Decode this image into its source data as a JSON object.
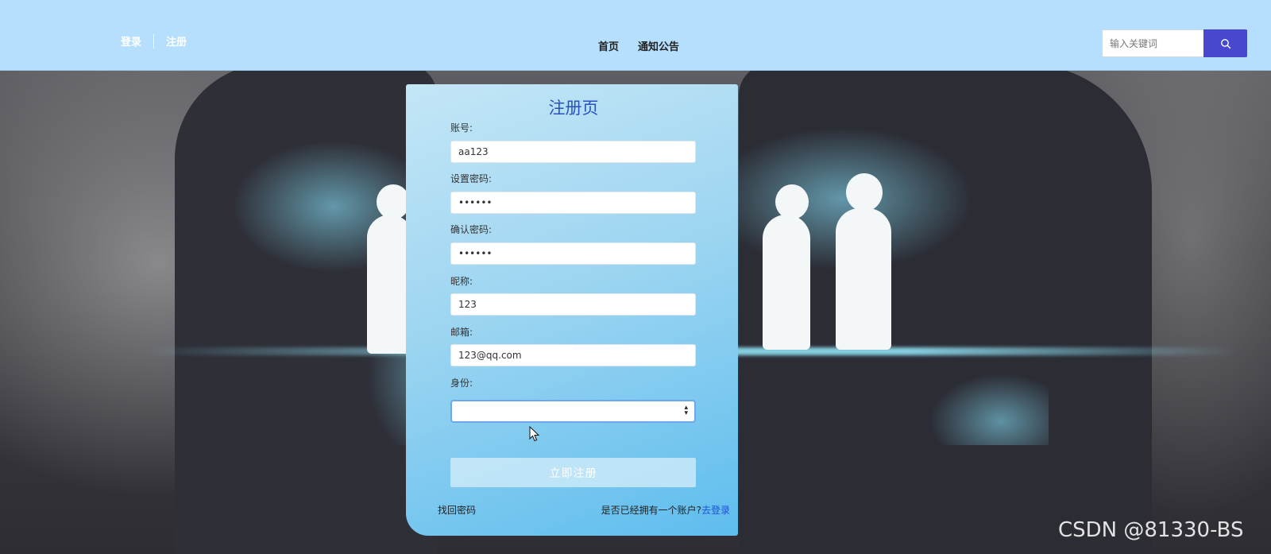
{
  "header": {
    "login_label": "登录",
    "register_label": "注册",
    "nav": [
      "首页",
      "通知公告"
    ],
    "search_placeholder": "输入关键词"
  },
  "form": {
    "title": "注册页",
    "fields": [
      {
        "label": "账号:",
        "value": "aa123"
      },
      {
        "label": "设置密码:",
        "value": "••••••"
      },
      {
        "label": "确认密码:",
        "value": "••••••"
      },
      {
        "label": "昵称:",
        "value": "123"
      },
      {
        "label": "邮箱:",
        "value": "123@qq.com"
      }
    ],
    "role_label": "身份:",
    "role_value": "",
    "submit_label": "立即注册",
    "forgot_label": "找回密码",
    "have_account_text": "是否已经拥有一个账户?",
    "go_login_label": "去登录"
  },
  "watermark": "CSDN @81330-BS",
  "colors": {
    "topbar": "#b5dffc",
    "search_button": "#4748cf",
    "title": "#2a52be",
    "link": "#1f4fd8"
  },
  "icons": {
    "search": "search-icon",
    "cursor": "mouse-cursor-icon",
    "select_arrows": "select-arrows-icon"
  }
}
